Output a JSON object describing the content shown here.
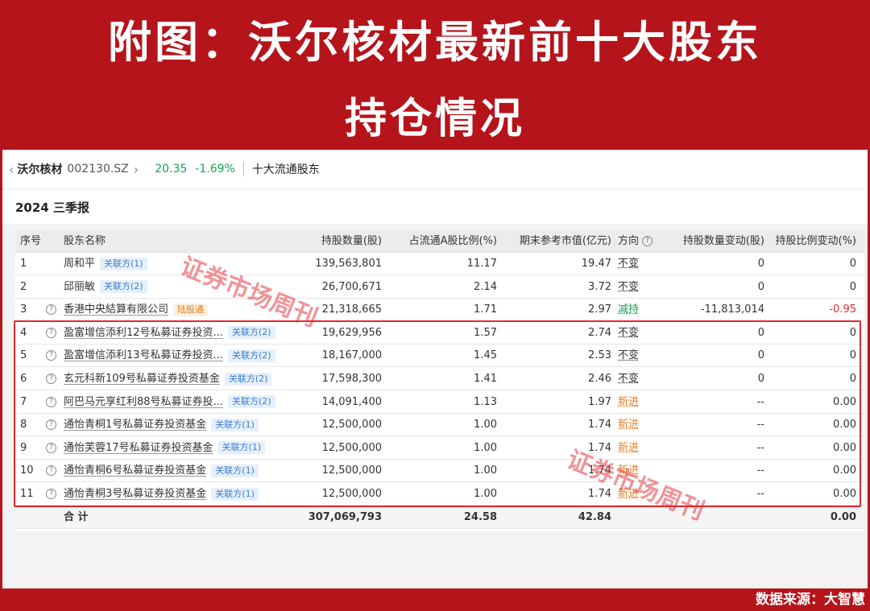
{
  "banner": {
    "line1": "附图：沃尔核材最新前十大股东",
    "line2": "持仓情况"
  },
  "topbar": {
    "stock_name": "沃尔核材",
    "stock_code": "002130.SZ",
    "price": "20.35",
    "change": "-1.69%",
    "section": "十大流通股东"
  },
  "report_period": "2024 三季报",
  "columns": {
    "idx": "序号",
    "name": "股东名称",
    "shares": "持股数量(股)",
    "ratio": "占流通A股比例(%)",
    "value": "期末参考市值(亿元)",
    "direction": "方向",
    "shares_change": "持股数量变动(股)",
    "ratio_change": "持股比例变动(%)"
  },
  "rows": [
    {
      "idx": "1",
      "name": "周和平",
      "tag": "关联方(1)",
      "tag_color": "blue",
      "shares": "139,563,801",
      "ratio": "11.17",
      "value": "19.47",
      "direction": "不变",
      "dir_color": "#333333",
      "chg": "0",
      "chgpct": "0"
    },
    {
      "idx": "2",
      "name": "邱丽敏",
      "tag": "关联方(2)",
      "tag_color": "blue",
      "shares": "26,700,671",
      "ratio": "2.14",
      "value": "3.72",
      "direction": "不变",
      "dir_color": "#333333",
      "chg": "0",
      "chgpct": "0"
    },
    {
      "idx": "3",
      "name": "香港中央結算有限公司",
      "tag": "陆股通",
      "tag_color": "orange",
      "shares": "21,318,665",
      "ratio": "1.71",
      "value": "2.97",
      "direction": "减持",
      "dir_color": "#16a34a",
      "chg": "-11,813,014",
      "chgpct": "-0.95"
    },
    {
      "idx": "4",
      "name": "盈富增信添利12号私募证券投资...",
      "tag": "关联方(2)",
      "tag_color": "blue",
      "shares": "19,629,956",
      "ratio": "1.57",
      "value": "2.74",
      "direction": "不变",
      "dir_color": "#333333",
      "chg": "0",
      "chgpct": "0"
    },
    {
      "idx": "5",
      "name": "盈富增信添利13号私募证券投资...",
      "tag": "关联方(2)",
      "tag_color": "blue",
      "shares": "18,167,000",
      "ratio": "1.45",
      "value": "2.53",
      "direction": "不变",
      "dir_color": "#333333",
      "chg": "0",
      "chgpct": "0"
    },
    {
      "idx": "6",
      "name": "玄元科新109号私募证券投资基金",
      "tag": "关联方(2)",
      "tag_color": "blue",
      "shares": "17,598,300",
      "ratio": "1.41",
      "value": "2.46",
      "direction": "不变",
      "dir_color": "#333333",
      "chg": "0",
      "chgpct": "0"
    },
    {
      "idx": "7",
      "name": "阿巴马元享红利88号私募证券投...",
      "tag": "关联方(2)",
      "tag_color": "blue",
      "shares": "14,091,400",
      "ratio": "1.13",
      "value": "1.97",
      "direction": "新进",
      "dir_color": "#e67e22",
      "chg": "--",
      "chgpct": "0.00"
    },
    {
      "idx": "8",
      "name": "通怡青桐1号私募证券投资基金",
      "tag": "关联方(1)",
      "tag_color": "blue",
      "shares": "12,500,000",
      "ratio": "1.00",
      "value": "1.74",
      "direction": "新进",
      "dir_color": "#e67e22",
      "chg": "--",
      "chgpct": "0.00"
    },
    {
      "idx": "9",
      "name": "通怡芙蓉17号私募证券投资基金",
      "tag": "关联方(1)",
      "tag_color": "blue",
      "shares": "12,500,000",
      "ratio": "1.00",
      "value": "1.74",
      "direction": "新进",
      "dir_color": "#e67e22",
      "chg": "--",
      "chgpct": "0.00"
    },
    {
      "idx": "10",
      "name": "通怡青桐6号私募证券投资基金",
      "tag": "关联方(1)",
      "tag_color": "blue",
      "shares": "12,500,000",
      "ratio": "1.00",
      "value": "1.74",
      "direction": "新进",
      "dir_color": "#e67e22",
      "chg": "--",
      "chgpct": "0.00"
    },
    {
      "idx": "11",
      "name": "通怡青桐3号私募证券投资基金",
      "tag": "关联方(1)",
      "tag_color": "blue",
      "shares": "12,500,000",
      "ratio": "1.00",
      "value": "1.74",
      "direction": "新进",
      "dir_color": "#e67e22",
      "chg": "--",
      "chgpct": "0.00"
    }
  ],
  "total": {
    "label": "合 计",
    "shares": "307,069,793",
    "ratio": "24.58",
    "value": "42.84",
    "chgpct": "0.00"
  },
  "watermark_text": "证券市场周刊",
  "source": "数据来源：大智慧",
  "colors": {
    "banner_red": "#b5141b",
    "highlight_box": "#e0282d",
    "price_green": "#16a34a",
    "new_orange": "#e67e22",
    "tag_blue": "#3a7bd5"
  }
}
